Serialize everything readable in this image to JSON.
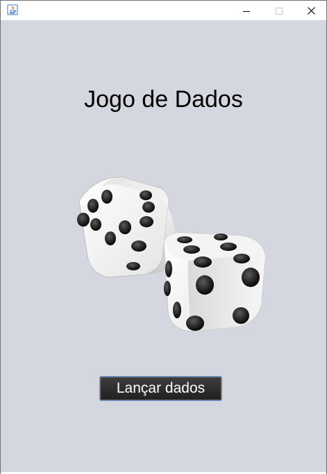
{
  "window": {
    "title": "",
    "controls": {
      "minimize": "minimize-icon",
      "maximize": "maximize-icon",
      "close": "close-icon"
    }
  },
  "main": {
    "heading": "Jogo de Dados",
    "image": "dice-pair",
    "roll_button_label": "Lançar dados"
  },
  "colors": {
    "content_background": "#d4d7e0",
    "button_background": "#2b2b2b",
    "button_border": "#5c8fd4",
    "button_text": "#ffffff"
  }
}
